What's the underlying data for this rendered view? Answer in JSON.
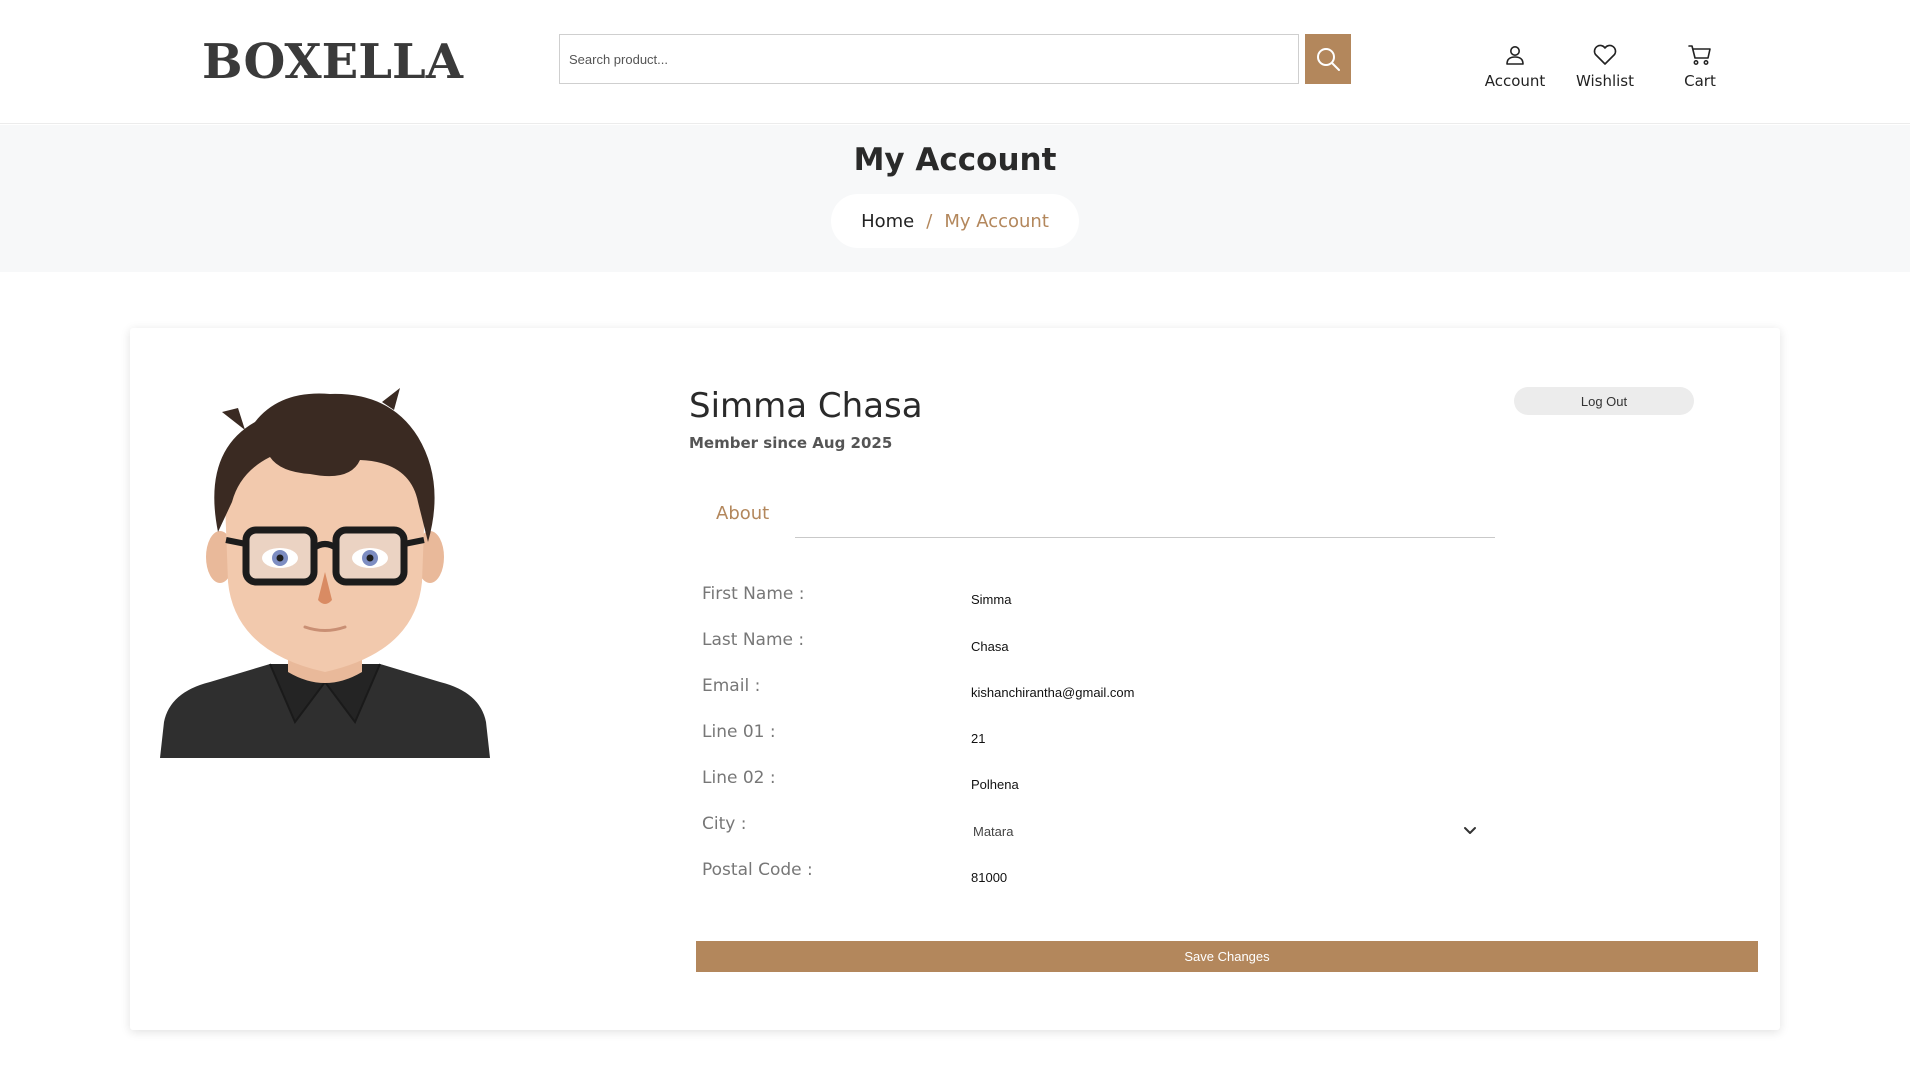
{
  "header": {
    "logo": "BOXELLA",
    "search_placeholder": "Search product...",
    "nav": {
      "account": "Account",
      "wishlist": "Wishlist",
      "cart": "Cart"
    }
  },
  "banner": {
    "title": "My Account",
    "breadcrumb": {
      "home": "Home",
      "separator": "/",
      "current": "My Account"
    }
  },
  "profile": {
    "name": "Simma Chasa",
    "member_since": "Member since Aug 2025",
    "logout_label": "Log Out",
    "tab_about": "About",
    "fields": {
      "first_name": {
        "label": "First Name :",
        "value": "Simma"
      },
      "last_name": {
        "label": "Last Name :",
        "value": "Chasa"
      },
      "email": {
        "label": "Email :",
        "value": "kishanchirantha@gmail.com"
      },
      "line1": {
        "label": "Line 01 :",
        "value": "21"
      },
      "line2": {
        "label": "Line 02 :",
        "value": "Polhena"
      },
      "city": {
        "label": "City :",
        "value": "Matara"
      },
      "postal_code": {
        "label": "Postal Code :",
        "value": "81000"
      }
    },
    "save_label": "Save Changes"
  },
  "icons": {
    "search": "search-icon",
    "account": "user-icon",
    "wishlist": "heart-icon",
    "cart": "cart-icon",
    "dropdown": "chevron-down-icon"
  },
  "colors": {
    "accent": "#b3875c",
    "banner_bg": "#f7f8f9",
    "logout_bg": "#ececec"
  }
}
